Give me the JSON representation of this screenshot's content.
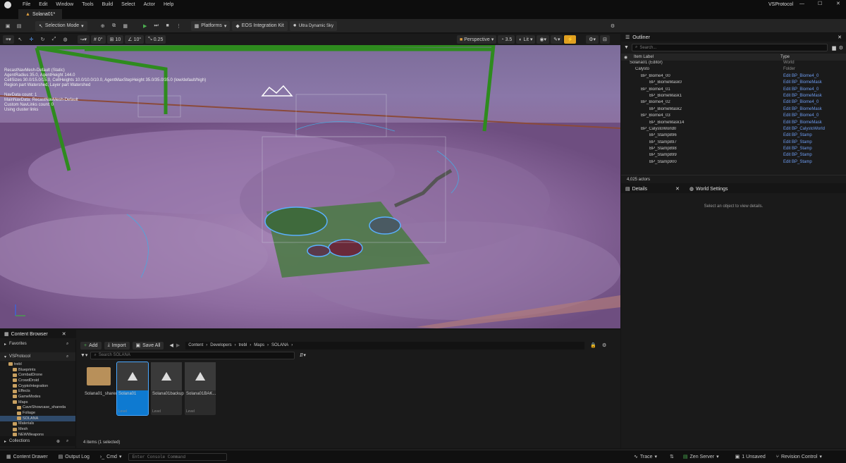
{
  "menu": [
    "File",
    "Edit",
    "Window",
    "Tools",
    "Build",
    "Select",
    "Actor",
    "Help"
  ],
  "window_title": "VSProtocol",
  "document_tab": "Solana01*",
  "toolbar": {
    "selection_mode": "Selection Mode",
    "platforms": "Platforms",
    "eos": "EOS Integration Kit",
    "sky": "Ultra Dynamic Sky"
  },
  "viewport_toolbar": {
    "snap1": "0°",
    "snap2": "10",
    "snap3": "10°",
    "snap4": "0.25",
    "perspective": "Perspective",
    "speed": "3.5",
    "lit": "Lit"
  },
  "viewport_stats": [
    "RecastNavMesh-Default (Static)",
    "AgentRadius 35.0, AgentHeight 144.0",
    "CellSizes 30.0/15.0/15.0, CellHeights 10.0/10.0/10.0, AgentMaxStepHeight 35.0/35.0/35.0 (low/default/high)",
    "Region part Watershed, Layer part Watershed",
    "",
    "NavData count: 1",
    "MainNavData: RecastNavMesh-Default",
    "Custom NavLinks count: 0",
    "Using cluster links"
  ],
  "outliner": {
    "title": "Outliner",
    "search_placeholder": "Search...",
    "col_label": "Item Label",
    "col_type": "Type",
    "rows": [
      {
        "label": "Solana01 (Editor)",
        "type": "World",
        "link": false
      },
      {
        "label": "Calysto",
        "type": "Folder",
        "link": false
      },
      {
        "label": "BP_Biome4_00",
        "type": "Edit BP_Biome4_0",
        "link": true
      },
      {
        "label": "BP_BiomeMask0",
        "type": "Edit BP_BiomeMask",
        "link": true
      },
      {
        "label": "BP_Biome4_01",
        "type": "Edit BP_Biome4_0",
        "link": true
      },
      {
        "label": "BP_BiomeMask1",
        "type": "Edit BP_BiomeMask",
        "link": true
      },
      {
        "label": "BP_Biome4_02",
        "type": "Edit BP_Biome4_0",
        "link": true
      },
      {
        "label": "BP_BiomeMask2",
        "type": "Edit BP_BiomeMask",
        "link": true
      },
      {
        "label": "BP_Biome4_03",
        "type": "Edit BP_Biome4_0",
        "link": true
      },
      {
        "label": "BP_BiomeMask14",
        "type": "Edit BP_BiomeMask",
        "link": true
      },
      {
        "label": "BP_CalystoWorld0",
        "type": "Edit BP_CalystoWorld",
        "link": true
      },
      {
        "label": "BP_Stamp896",
        "type": "Edit BP_Stamp",
        "link": true
      },
      {
        "label": "BP_Stamp897",
        "type": "Edit BP_Stamp",
        "link": true
      },
      {
        "label": "BP_Stamp898",
        "type": "Edit BP_Stamp",
        "link": true
      },
      {
        "label": "BP_Stamp899",
        "type": "Edit BP_Stamp",
        "link": true
      },
      {
        "label": "BP_Stamp900",
        "type": "Edit BP_Stamp",
        "link": true
      }
    ],
    "actor_count": "4,025 actors"
  },
  "details": {
    "tab1": "Details",
    "tab2": "World Settings",
    "empty_msg": "Select an object to view details."
  },
  "content_browser": {
    "title": "Content Browser",
    "add": "Add",
    "import": "Import",
    "save_all": "Save All",
    "path": [
      "Content",
      "Developers",
      "trebl",
      "Maps",
      "SOLANA"
    ],
    "search_placeholder": "Search SOLANA",
    "favorites": "Favorites",
    "project": "VSProtocol",
    "tree": [
      {
        "label": "trebl",
        "depth": 0
      },
      {
        "label": "Blueprints",
        "depth": 1
      },
      {
        "label": "CombatDrone",
        "depth": 1
      },
      {
        "label": "CrowdDroid",
        "depth": 1
      },
      {
        "label": "CryptoIntegration",
        "depth": 1
      },
      {
        "label": "Effects",
        "depth": 1
      },
      {
        "label": "GameModes",
        "depth": 1
      },
      {
        "label": "Maps",
        "depth": 1
      },
      {
        "label": "CaveShowcase_shareda",
        "depth": 2
      },
      {
        "label": "Foliage",
        "depth": 2
      },
      {
        "label": "SOLANA",
        "depth": 2
      },
      {
        "label": "Materials",
        "depth": 1
      },
      {
        "label": "Mesh",
        "depth": 1
      },
      {
        "label": "NEWWeapons",
        "depth": 1
      }
    ],
    "assets": [
      {
        "name": "Solana01_sharedassets",
        "cls": ""
      },
      {
        "name": "Solana01",
        "cls": "Level"
      },
      {
        "name": "Solana01backup",
        "cls": "Level"
      },
      {
        "name": "Solana01BAK...",
        "cls": "Level"
      }
    ],
    "item_count": "4 items (1 selected)",
    "collections": "Collections"
  },
  "statusbar": {
    "content_drawer": "Content Drawer",
    "output_log": "Output Log",
    "cmd": "Cmd",
    "console_placeholder": "Enter Console Command",
    "trace": "Trace",
    "zen": "Zen Server",
    "unsaved": "1 Unsaved",
    "revision": "Revision Control"
  },
  "colors": {
    "accent": "#0e7ad1",
    "link": "#6e9cf0",
    "navmesh": "#2e8b1e"
  }
}
